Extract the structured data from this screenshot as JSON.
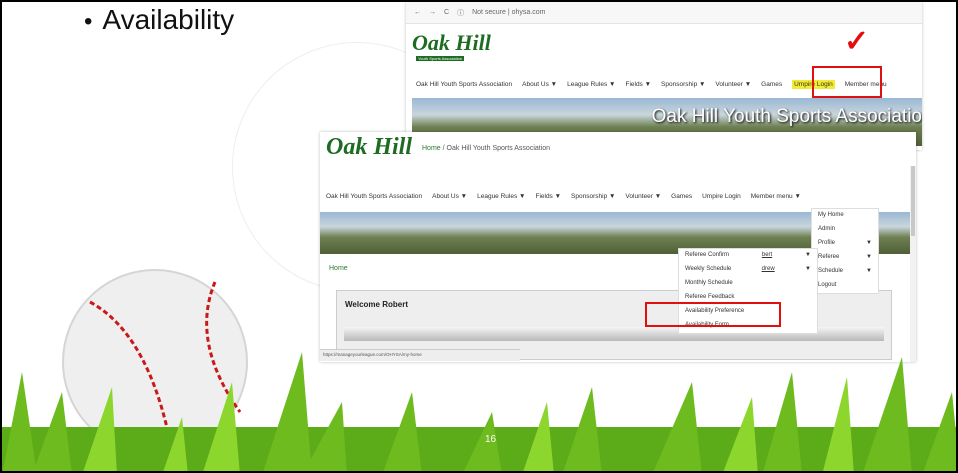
{
  "slide": {
    "bullet": "Availability",
    "page_number": "16"
  },
  "ss1": {
    "url": "Not secure | ohysa.com",
    "logo": "Oak Hill",
    "logo_sub": "Youth Sports Association",
    "nav": [
      "Oak Hill Youth Sports Association",
      "About Us ▼",
      "League Rules ▼",
      "Fields ▼",
      "Sponsorship ▼",
      "Volunteer ▼",
      "Games",
      "Umpire Login",
      "Member menu"
    ],
    "banner_title": "Oak Hill Youth Sports Associatio"
  },
  "ss2": {
    "logo": "Oak Hill",
    "breadcrumb": {
      "home": "Home",
      "separator": "/",
      "current": "Oak Hill Youth Sports Association"
    },
    "nav": [
      "Oak Hill Youth Sports Association",
      "About Us ▼",
      "League Rules ▼",
      "Fields ▼",
      "Sponsorship ▼",
      "Volunteer ▼",
      "Games",
      "Umpire Login",
      "Member menu ▼"
    ],
    "member_menu": [
      {
        "label": "My Home",
        "arrow": ""
      },
      {
        "label": "Admin",
        "arrow": ""
      },
      {
        "label": "Profile",
        "arrow": "▼"
      },
      {
        "label": "Referee",
        "arrow": "▼"
      },
      {
        "label": "Schedule",
        "arrow": "▼"
      },
      {
        "label": "Logout",
        "arrow": ""
      }
    ],
    "referee_menu": [
      {
        "label": "Referee Confirm",
        "extra": "bert",
        "arrow": "▼"
      },
      {
        "label": "Weekly Schedule",
        "extra": "drew",
        "arrow": "▼"
      },
      {
        "label": "Monthly Schedule",
        "extra": "",
        "arrow": ""
      },
      {
        "label": "Referee Feedback",
        "extra": "",
        "arrow": ""
      },
      {
        "label": "Availability Preference",
        "extra": "",
        "arrow": ""
      },
      {
        "label": "Availability Form",
        "extra": "",
        "arrow": ""
      }
    ],
    "home_link": "Home",
    "welcome": "Welcome Robert",
    "status_url": "https://manageyourleague.com/OHYSA/my-home"
  },
  "colors": {
    "accent_red": "#e01010",
    "highlight": "#f3ea32",
    "brand_green": "#1e6b22"
  }
}
